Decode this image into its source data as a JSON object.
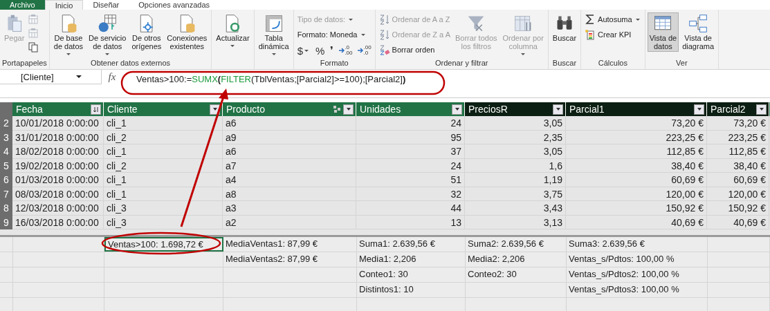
{
  "ribbon_tabs": [
    {
      "label": "Archivo",
      "selected": false,
      "kind": "file"
    },
    {
      "label": "Inicio",
      "selected": true,
      "kind": "tab"
    },
    {
      "label": "Diseñar",
      "selected": false,
      "kind": "tab"
    },
    {
      "label": "Opciones avanzadas",
      "selected": false,
      "kind": "tab"
    }
  ],
  "ribbon_groups": [
    {
      "label": "Portapapeles",
      "sections": [
        {
          "kind": "large",
          "label": "Pegar",
          "disabled": true,
          "dropdown": false
        },
        {
          "kind": "icons",
          "items": [
            {
              "disabled": true
            },
            {
              "disabled": true
            },
            {
              "disabled": false
            }
          ]
        }
      ]
    },
    {
      "label": "Obtener datos externos",
      "sections": [
        {
          "kind": "large",
          "label": "De base\nde datos",
          "disabled": false,
          "dropdown": true
        },
        {
          "kind": "large",
          "label": "De servicio\nde datos",
          "disabled": false,
          "dropdown": true
        },
        {
          "kind": "large",
          "label": "De otros\norígenes",
          "disabled": false,
          "dropdown": false
        },
        {
          "kind": "large",
          "label": "Conexiones\nexistentes",
          "disabled": false,
          "dropdown": false
        }
      ]
    },
    {
      "sections": [
        {
          "kind": "large",
          "label": "Actualizar",
          "disabled": false,
          "dropdown": true
        }
      ]
    },
    {
      "sections": [
        {
          "kind": "large",
          "label": "Tabla\ndinámica",
          "disabled": false,
          "dropdown": true
        }
      ]
    },
    {
      "label": "Formato",
      "sections": [
        {
          "kind": "stack",
          "items": [
            {
              "kind": "text",
              "label": "Tipo de datos:",
              "disabled": true,
              "dropdown": true
            },
            {
              "kind": "text",
              "label": "Formato: Moneda",
              "disabled": false,
              "dropdown": true
            },
            {
              "kind": "symbols",
              "buttons": [
                {
                  "text": "$",
                  "dropdown": true,
                  "arrow": false
                },
                {
                  "text": "%",
                  "dropdown": false,
                  "arrow": false
                },
                {
                  "text": "❜",
                  "dropdown": false,
                  "arrow": false
                },
                {
                  "text": ".0\n.00",
                  "dropdown": false,
                  "arrow": true
                },
                {
                  "text": ".00\n.0",
                  "dropdown": false,
                  "arrow": true
                }
              ]
            }
          ]
        }
      ]
    },
    {
      "label": "Ordenar y filtrar",
      "sections": [
        {
          "kind": "stack",
          "items": [
            {
              "kind": "icon",
              "label": "Ordenar de A a Z",
              "disabled": true,
              "dropdown": false
            },
            {
              "kind": "icon",
              "label": "Ordenar de Z a A",
              "disabled": true,
              "dropdown": false
            },
            {
              "kind": "icon",
              "label": "Borrar orden",
              "disabled": false,
              "dropdown": false
            }
          ]
        },
        {
          "kind": "large",
          "label": "Borrar todos\nlos filtros",
          "disabled": true,
          "dropdown": false
        },
        {
          "kind": "large",
          "label": "Ordenar por\ncolumna",
          "disabled": true,
          "dropdown": true
        }
      ]
    },
    {
      "label": "Buscar",
      "sections": [
        {
          "kind": "large",
          "label": "Buscar",
          "disabled": false,
          "dropdown": false
        }
      ]
    },
    {
      "label": "Cálculos",
      "sections": [
        {
          "kind": "stack",
          "items": [
            {
              "kind": "icon",
              "label": "Autosuma",
              "disabled": false,
              "dropdown": true
            },
            {
              "kind": "icon",
              "label": "Crear KPI",
              "disabled": false,
              "dropdown": false
            }
          ]
        }
      ]
    },
    {
      "label": "Ver",
      "sections": [
        {
          "kind": "large",
          "label": "Vista de\ndatos",
          "selected": true,
          "disabled": false,
          "dropdown": false
        },
        {
          "kind": "large",
          "label": "Vista de\ndiagrama",
          "selected": false,
          "disabled": false,
          "dropdown": false
        }
      ]
    }
  ],
  "formula_bar": {
    "name_box": "[Cliente]",
    "fx": "fx",
    "tokens": [
      {
        "text": "Ventas>100:=",
        "kind": "plain"
      },
      {
        "text": "SUMX",
        "kind": "function"
      },
      {
        "text": "(",
        "kind": "paren"
      },
      {
        "text": "FILTER",
        "kind": "function"
      },
      {
        "text": "(TblVentas;[Parcial2]>=100);[Parcial2]",
        "kind": "plain"
      },
      {
        "text": ")",
        "kind": "paren"
      }
    ]
  },
  "columns": [
    {
      "name": "Fecha",
      "kind": "text",
      "calculated": false,
      "sorted": true,
      "related": false
    },
    {
      "name": "Cliente",
      "kind": "text",
      "calculated": false,
      "sorted": false,
      "related": false,
      "measures": [
        {
          "text": "Ventas>100: 1.698,72 €",
          "selected": true
        }
      ]
    },
    {
      "name": "Producto",
      "kind": "text",
      "calculated": false,
      "sorted": false,
      "related": true,
      "measures": [
        {
          "text": "MediaVentas1: 87,99 €",
          "selected": false
        },
        {
          "text": "MediaVentas2: 87,99 €",
          "selected": false
        }
      ]
    },
    {
      "name": "Unidades",
      "kind": "number",
      "calculated": false,
      "sorted": false,
      "related": false,
      "measures": [
        {
          "text": "Suma1: 2.639,56 €",
          "selected": false
        },
        {
          "text": "Media1: 2,206",
          "selected": false
        },
        {
          "text": "Conteo1: 30",
          "selected": false
        },
        {
          "text": "Distintos1: 10",
          "selected": false
        }
      ]
    },
    {
      "name": "PreciosR",
      "kind": "number",
      "calculated": true,
      "sorted": false,
      "related": false,
      "measures": [
        {
          "text": "Suma2: 2.639,56 €",
          "selected": false
        },
        {
          "text": "Media2: 2,206",
          "selected": false
        },
        {
          "text": "Conteo2: 30",
          "selected": false
        }
      ]
    },
    {
      "name": "Parcial1",
      "kind": "number",
      "calculated": true,
      "sorted": false,
      "related": false,
      "measures": [
        {
          "text": "Suma3: 2.639,56 €",
          "selected": false
        },
        {
          "text": "Ventas_s/Pdtos: 100,00 %",
          "selected": false
        },
        {
          "text": "Ventas_s/Pdtos2: 100,00 %",
          "selected": false
        },
        {
          "text": "Ventas_s/Pdtos3: 100,00 %",
          "selected": false
        }
      ]
    },
    {
      "name": "Parcial2",
      "kind": "number",
      "calculated": true,
      "sorted": false,
      "related": false
    }
  ],
  "rows": [
    {
      "num": "2",
      "cells": [
        "10/01/2018 0:00:00",
        "cli_1",
        "a6",
        "24",
        "3,05",
        "73,20 €",
        "73,20 €"
      ]
    },
    {
      "num": "3",
      "cells": [
        "31/01/2018 0:00:00",
        "cli_2",
        "a9",
        "95",
        "2,35",
        "223,25 €",
        "223,25 €"
      ]
    },
    {
      "num": "4",
      "cells": [
        "18/02/2018 0:00:00",
        "cli_1",
        "a6",
        "37",
        "3,05",
        "112,85 €",
        "112,85 €"
      ]
    },
    {
      "num": "5",
      "cells": [
        "19/02/2018 0:00:00",
        "cli_2",
        "a7",
        "24",
        "1,6",
        "38,40 €",
        "38,40 €"
      ]
    },
    {
      "num": "6",
      "cells": [
        "01/03/2018 0:00:00",
        "cli_1",
        "a4",
        "51",
        "1,19",
        "60,69 €",
        "60,69 €"
      ]
    },
    {
      "num": "7",
      "cells": [
        "08/03/2018 0:00:00",
        "cli_1",
        "a8",
        "32",
        "3,75",
        "120,00 €",
        "120,00 €"
      ]
    },
    {
      "num": "8",
      "cells": [
        "12/03/2018 0:00:00",
        "cli_3",
        "a3",
        "44",
        "3,43",
        "150,92 €",
        "150,92 €"
      ]
    },
    {
      "num": "9",
      "cells": [
        "16/03/2018 0:00:00",
        "cli_3",
        "a2",
        "13",
        "3,13",
        "40,69 €",
        "40,69 €"
      ]
    }
  ]
}
